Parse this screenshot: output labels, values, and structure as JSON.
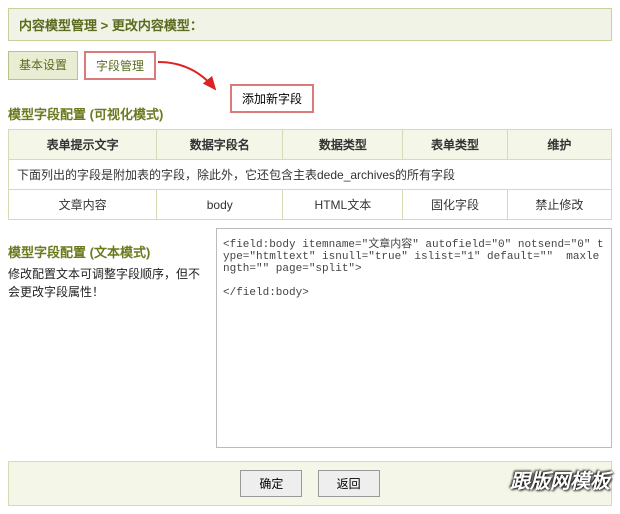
{
  "breadcrumb": "内容模型管理 > 更改内容模型：",
  "tabs": {
    "basic": "基本设置",
    "fields": "字段管理"
  },
  "addField": "添加新字段",
  "visualTitle": "模型字段配置 (可视化模式)",
  "headers": {
    "c1": "表单提示文字",
    "c2": "数据字段名",
    "c3": "数据类型",
    "c4": "表单类型",
    "c5": "维护"
  },
  "noteRow": "下面列出的字段是附加表的字段，除此外，它还包含主表dede_archives的所有字段",
  "row": {
    "c1": "文章内容",
    "c2": "body",
    "c3": "HTML文本",
    "c4": "固化字段",
    "c5": "禁止修改"
  },
  "textTitle": "模型字段配置 (文本模式)",
  "textDesc": "修改配置文本可调整字段顺序，但不会更改字段属性！",
  "code": "<field:body itemname=\"文章内容\" autofield=\"0\" notsend=\"0\" type=\"htmltext\" isnull=\"true\" islist=\"1\" default=\"\"  maxlength=\"\" page=\"split\">\n\n</field:body>",
  "buttons": {
    "ok": "确定",
    "back": "返回"
  },
  "watermark": "跟版网模板"
}
